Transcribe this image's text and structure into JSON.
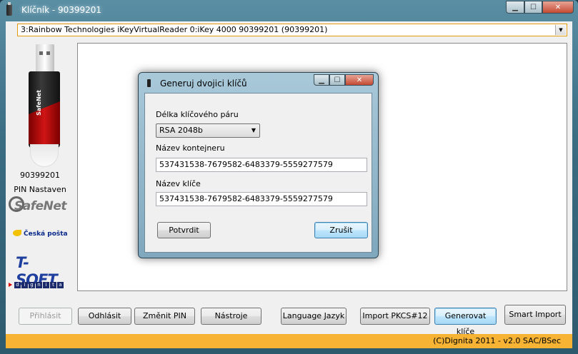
{
  "window": {
    "title": "Klíčník - 90399201",
    "min": "▁",
    "max": "☐",
    "close": "✕"
  },
  "reader": {
    "selected": "3:Rainbow Technologies iKeyVirtualReader 0:iKey 4000 90399201 (90399201)"
  },
  "token_panel": {
    "serial": "90399201",
    "pin_status": "PIN Nastaven",
    "token_brand": "SafeNet",
    "logo_safenet": "SafeNet",
    "logo_posta": "Česká pošta",
    "logo_tsoft": "T-SOFT",
    "logo_dignita": [
      "d",
      "i",
      "g",
      "n",
      "i",
      "t",
      "a"
    ]
  },
  "buttons": {
    "login": "Přihlásit",
    "logout": "Odhlásit",
    "change_pin": "Změnit PIN",
    "tools": "Nástroje",
    "language": "Language Jazyk",
    "import_pkcs": "Import PKCS#12",
    "generate_keys": "Generovat klíče",
    "smart_import": "Smart Import"
  },
  "status": {
    "text": "(C)Dignita 2011 - v2.0 SAC/BSec"
  },
  "dialog": {
    "title": "Generuj dvojici klíčů",
    "key_length_label": "Délka klíčového páru",
    "key_length_value": "RSA 2048b",
    "container_label": "Název kontejneru",
    "container_value": "537431538-7679582-6483379-5559277579",
    "key_label": "Název klíče",
    "key_value": "537431538-7679582-6483379-5559277579",
    "confirm": "Potvrdit",
    "cancel": "Zrušit"
  },
  "colors": {
    "accent_orange": "#f7b334",
    "focus_blue": "#3c7fb1"
  }
}
